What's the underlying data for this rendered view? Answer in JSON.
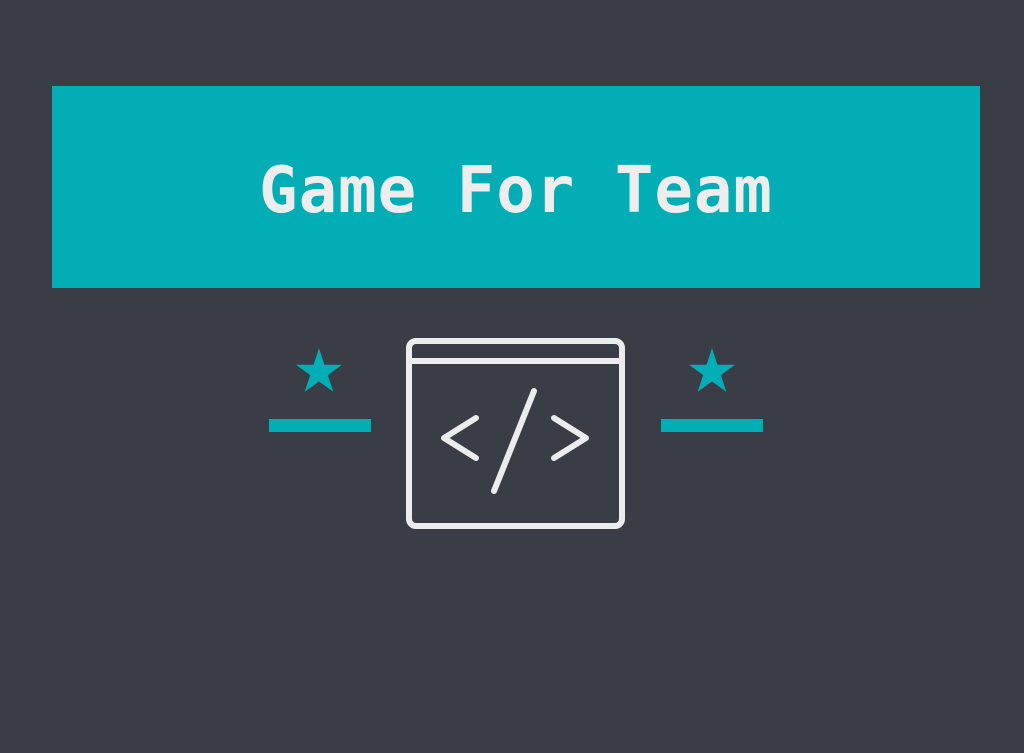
{
  "title": "Game For Team",
  "colors": {
    "background": "#3a3d45",
    "accent": "#02adb5",
    "icon_stroke": "#ececec",
    "title_text": "#ededed"
  },
  "emblem": {
    "left_icon": "star-icon",
    "center_icon": "code-window-icon",
    "right_icon": "star-icon"
  }
}
